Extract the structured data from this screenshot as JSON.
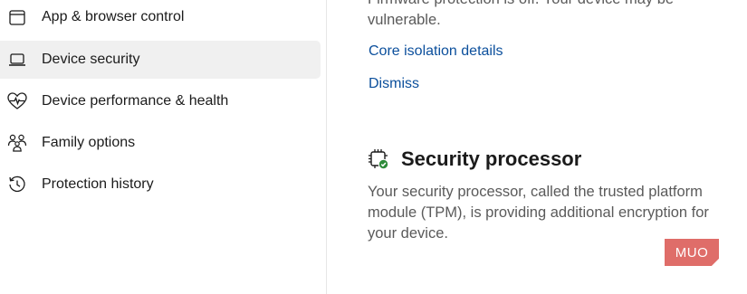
{
  "sidebar": {
    "items": [
      {
        "label": "App & browser control",
        "icon": "browser-window-icon"
      },
      {
        "label": "Device security",
        "icon": "laptop-icon",
        "selected": true
      },
      {
        "label": "Device performance & health",
        "icon": "heart-pulse-icon"
      },
      {
        "label": "Family options",
        "icon": "family-icon"
      },
      {
        "label": "Protection history",
        "icon": "history-icon"
      }
    ]
  },
  "main": {
    "previous_text": "Firmware protection is off. Your device may be vulnerable.",
    "core_isolation_link": "Core isolation details",
    "dismiss_link": "Dismiss",
    "security_processor": {
      "title": "Security processor",
      "description": "Your security processor, called the trusted platform module (TPM), is providing additional encryption for your device.",
      "icon": "chip-check-icon"
    }
  },
  "watermark": {
    "text": "MUO",
    "color": "#d9534f"
  },
  "colors": {
    "link": "#0b4f9c",
    "selected_bg": "#f0f0f0",
    "check_green": "#2e8b3a"
  }
}
